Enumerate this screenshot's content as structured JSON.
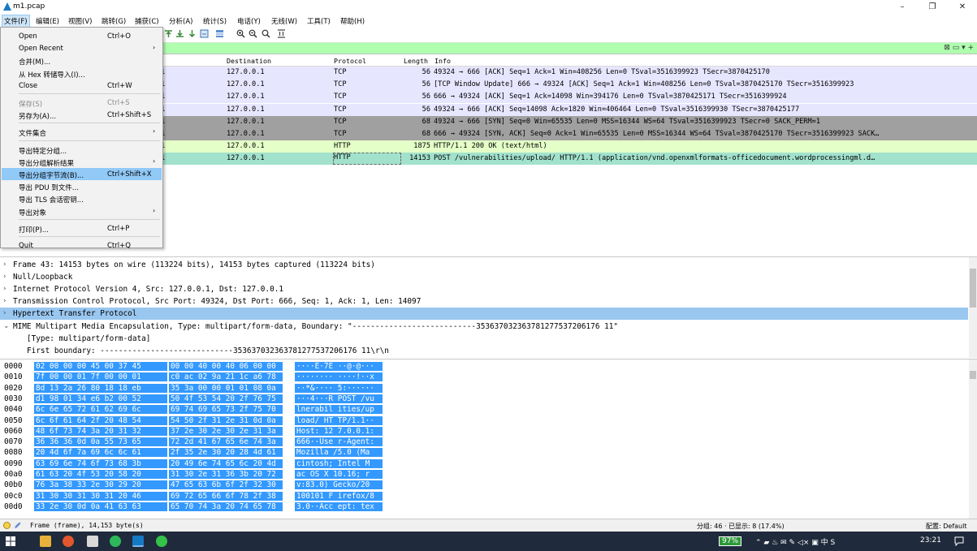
{
  "window": {
    "title": "m1.pcap",
    "minimize": "–",
    "maximize": "❐",
    "close": "✕"
  },
  "menubar": [
    "文件(F)",
    "编辑(E)",
    "视图(V)",
    "跳转(G)",
    "捕获(C)",
    "分析(A)",
    "统计(S)",
    "电话(Y)",
    "无线(W)",
    "工具(T)",
    "帮助(H)"
  ],
  "filter": {
    "buttons": "⊠ ▭ ▾ +"
  },
  "columns": {
    "destination": "Destination",
    "protocol": "Protocol",
    "length": "Length",
    "info": "Info"
  },
  "packets": [
    {
      "src_tail": "1",
      "dst": "127.0.0.1",
      "proto": "TCP",
      "len": "56",
      "info": "49324 → 666 [ACK] Seq=1 Ack=1 Win=408256 Len=0 TSval=3516399923 TSecr=3870425170",
      "bg": "#e7e6ff",
      "fg": "#000000"
    },
    {
      "src_tail": "1",
      "dst": "127.0.0.1",
      "proto": "TCP",
      "len": "56",
      "info": "[TCP Window Update] 666 → 49324 [ACK] Seq=1 Ack=1 Win=408256 Len=0 TSval=3870425170 TSecr=3516399923",
      "bg": "#e7e6ff",
      "fg": "#000000"
    },
    {
      "src_tail": "1",
      "dst": "127.0.0.1",
      "proto": "TCP",
      "len": "56",
      "info": "666 → 49324 [ACK] Seq=1 Ack=14098 Win=394176 Len=0 TSval=3870425171 TSecr=3516399924",
      "bg": "#e7e6ff",
      "fg": "#000000"
    },
    {
      "src_tail": "1",
      "dst": "127.0.0.1",
      "proto": "TCP",
      "len": "56",
      "info": "49324 → 666 [ACK] Seq=14098 Ack=1820 Win=406464 Len=0 TSval=3516399930 TSecr=3870425177",
      "bg": "#e7e6ff",
      "fg": "#000000"
    },
    {
      "src_tail": "1",
      "dst": "127.0.0.1",
      "proto": "TCP",
      "len": "68",
      "info": "49324 → 666 [SYN] Seq=0 Win=65535 Len=0 MSS=16344 WS=64 TSval=3516399923 TSecr=0 SACK_PERM=1",
      "bg": "#a0a0a0",
      "fg": "#000000"
    },
    {
      "src_tail": "1",
      "dst": "127.0.0.1",
      "proto": "TCP",
      "len": "68",
      "info": "666 → 49324 [SYN, ACK] Seq=0 Ack=1 Win=65535 Len=0 MSS=16344 WS=64 TSval=3870425170 TSecr=3516399923 SACK…",
      "bg": "#a0a0a0",
      "fg": "#000000"
    },
    {
      "src_tail": "1",
      "dst": "127.0.0.1",
      "proto": "HTTP",
      "len": "1875",
      "info": "HTTP/1.1 200 OK  (text/html)",
      "bg": "#e4ffc7",
      "fg": "#000000"
    },
    {
      "src_tail": "1",
      "dst": "127.0.0.1",
      "proto": "HTTP",
      "len": "14153",
      "info": "POST /vulnerabilities/upload/ HTTP/1.1  (application/vnd.openxmlformats-officedocument.wordprocessingml.d…",
      "bg": "#a2e2cd",
      "fg": "#000000"
    }
  ],
  "details": [
    {
      "arrow": "›",
      "text": "Frame 43: 14153 bytes on wire (113224 bits), 14153 bytes captured (113224 bits)",
      "indent": 0,
      "sel": false
    },
    {
      "arrow": "›",
      "text": "Null/Loopback",
      "indent": 0,
      "sel": false
    },
    {
      "arrow": "›",
      "text": "Internet Protocol Version 4, Src: 127.0.0.1, Dst: 127.0.0.1",
      "indent": 0,
      "sel": false
    },
    {
      "arrow": "›",
      "text": "Transmission Control Protocol, Src Port: 49324, Dst Port: 666, Seq: 1, Ack: 1, Len: 14097",
      "indent": 0,
      "sel": false
    },
    {
      "arrow": "›",
      "text": "Hypertext Transfer Protocol",
      "indent": 0,
      "sel": true
    },
    {
      "arrow": "⌄",
      "text": "MIME Multipart Media Encapsulation, Type: multipart/form-data, Boundary: \"---------------------------353637032363781277537206176 11\"",
      "indent": 0,
      "sel": false
    },
    {
      "arrow": "",
      "text": "[Type: multipart/form-data]",
      "indent": 1,
      "sel": false
    },
    {
      "arrow": "",
      "text": "First boundary: -----------------------------353637032363781277537206176 11\\r\\n",
      "indent": 1,
      "sel": false
    }
  ],
  "hex": [
    {
      "off": "0000",
      "b1": "02 00 00 00 45 00 37 45",
      "b2": "00 00 40 00 40 06 00 00",
      "asc": "····E·7E ··@·@···"
    },
    {
      "off": "0010",
      "b1": "7f 00 00 01 7f 00 00 01",
      "b2": "c0 ac 02 9a 21 1c a6 78",
      "asc": "········ ····!··x"
    },
    {
      "off": "0020",
      "b1": "8d 13 2a 26 80 18 18 eb",
      "b2": "35 3a 00 00 01 01 08 0a",
      "asc": "··*&···· 5:······"
    },
    {
      "off": "0030",
      "b1": "d1 98 01 34 e6 b2 00 52",
      "b2": "50 4f 53 54 20 2f 76 75",
      "asc": "···4···R POST /vu"
    },
    {
      "off": "0040",
      "b1": "6c 6e 65 72 61 62 69 6c",
      "b2": "69 74 69 65 73 2f 75 70",
      "asc": "lnerabil ities/up"
    },
    {
      "off": "0050",
      "b1": "6c 6f 61 64 2f 20 48 54",
      "b2": "54 50 2f 31 2e 31 0d 0a",
      "asc": "load/ HT TP/1.1··"
    },
    {
      "off": "0060",
      "b1": "48 6f 73 74 3a 20 31 32",
      "b2": "37 2e 30 2e 30 2e 31 3a",
      "asc": "Host: 12 7.0.0.1:"
    },
    {
      "off": "0070",
      "b1": "36 36 36 0d 0a 55 73 65",
      "b2": "72 2d 41 67 65 6e 74 3a",
      "asc": "666··Use r-Agent:"
    },
    {
      "off": "0080",
      "b1": "20 4d 6f 7a 69 6c 6c 61",
      "b2": "2f 35 2e 30 20 28 4d 61",
      "asc": " Mozilla /5.0 (Ma"
    },
    {
      "off": "0090",
      "b1": "63 69 6e 74 6f 73 68 3b",
      "b2": "20 49 6e 74 65 6c 20 4d",
      "asc": "cintosh;  Intel M"
    },
    {
      "off": "00a0",
      "b1": "61 63 20 4f 53 20 58 20",
      "b2": "31 30 2e 31 36 3b 20 72",
      "asc": "ac OS X  10.16; r"
    },
    {
      "off": "00b0",
      "b1": "76 3a 38 33 2e 30 29 20",
      "b2": "47 65 63 6b 6f 2f 32 30",
      "asc": "v:83.0)  Gecko/20"
    },
    {
      "off": "00c0",
      "b1": "31 30 30 31 30 31 20 46",
      "b2": "69 72 65 66 6f 78 2f 38",
      "asc": "100101 F irefox/8"
    },
    {
      "off": "00d0",
      "b1": "33 2e 30 0d 0a 41 63 63",
      "b2": "65 70 74 3a 20 74 65 78",
      "asc": "3.0··Acc ept: tex"
    }
  ],
  "status": {
    "frame": "Frame (frame), 14,153 byte(s)",
    "packets": "分组: 46 · 已显示: 8 (17.4%)",
    "profile": "配置: Default"
  },
  "taskbar": {
    "battery": "97%",
    "clock": "23:21",
    "tray": "⌃ ▰ ♨ ✉ ✎ ◁× ▣ 中 S"
  },
  "filemenu": [
    {
      "label": "Open",
      "shortcut": "Ctrl+O",
      "arrow": "",
      "hl": false,
      "dis": false
    },
    {
      "label": "Open Recent",
      "shortcut": "",
      "arrow": "›",
      "hl": false,
      "dis": false
    },
    {
      "label": "合并(M)...",
      "shortcut": "",
      "arrow": "",
      "hl": false,
      "dis": false
    },
    {
      "label": "从 Hex 转储导入(I)...",
      "shortcut": "",
      "arrow": "",
      "hl": false,
      "dis": false
    },
    {
      "label": "Close",
      "shortcut": "Ctrl+W",
      "arrow": "",
      "hl": false,
      "dis": false
    },
    {
      "sep": true
    },
    {
      "label": "保存(S)",
      "shortcut": "Ctrl+S",
      "arrow": "",
      "hl": false,
      "dis": true
    },
    {
      "label": "另存为(A)...",
      "shortcut": "Ctrl+Shift+S",
      "arrow": "",
      "hl": false,
      "dis": false
    },
    {
      "sep": true
    },
    {
      "label": "文件集合",
      "shortcut": "",
      "arrow": "›",
      "hl": false,
      "dis": false
    },
    {
      "sep": true
    },
    {
      "label": "导出特定分组...",
      "shortcut": "",
      "arrow": "",
      "hl": false,
      "dis": false
    },
    {
      "label": "导出分组解析结果",
      "shortcut": "",
      "arrow": "›",
      "hl": false,
      "dis": false
    },
    {
      "label": "导出分组字节流(B)...",
      "shortcut": "Ctrl+Shift+X",
      "arrow": "",
      "hl": true,
      "dis": false
    },
    {
      "label": "导出 PDU 到文件...",
      "shortcut": "",
      "arrow": "",
      "hl": false,
      "dis": false
    },
    {
      "label": "导出 TLS 会话密钥...",
      "shortcut": "",
      "arrow": "",
      "hl": false,
      "dis": false
    },
    {
      "label": "导出对象",
      "shortcut": "",
      "arrow": "›",
      "hl": false,
      "dis": false
    },
    {
      "sep": true
    },
    {
      "label": "打印(P)...",
      "shortcut": "Ctrl+P",
      "arrow": "",
      "hl": false,
      "dis": false
    },
    {
      "sep": true
    },
    {
      "label": "Quit",
      "shortcut": "Ctrl+Q",
      "arrow": "",
      "hl": false,
      "dis": false
    }
  ]
}
